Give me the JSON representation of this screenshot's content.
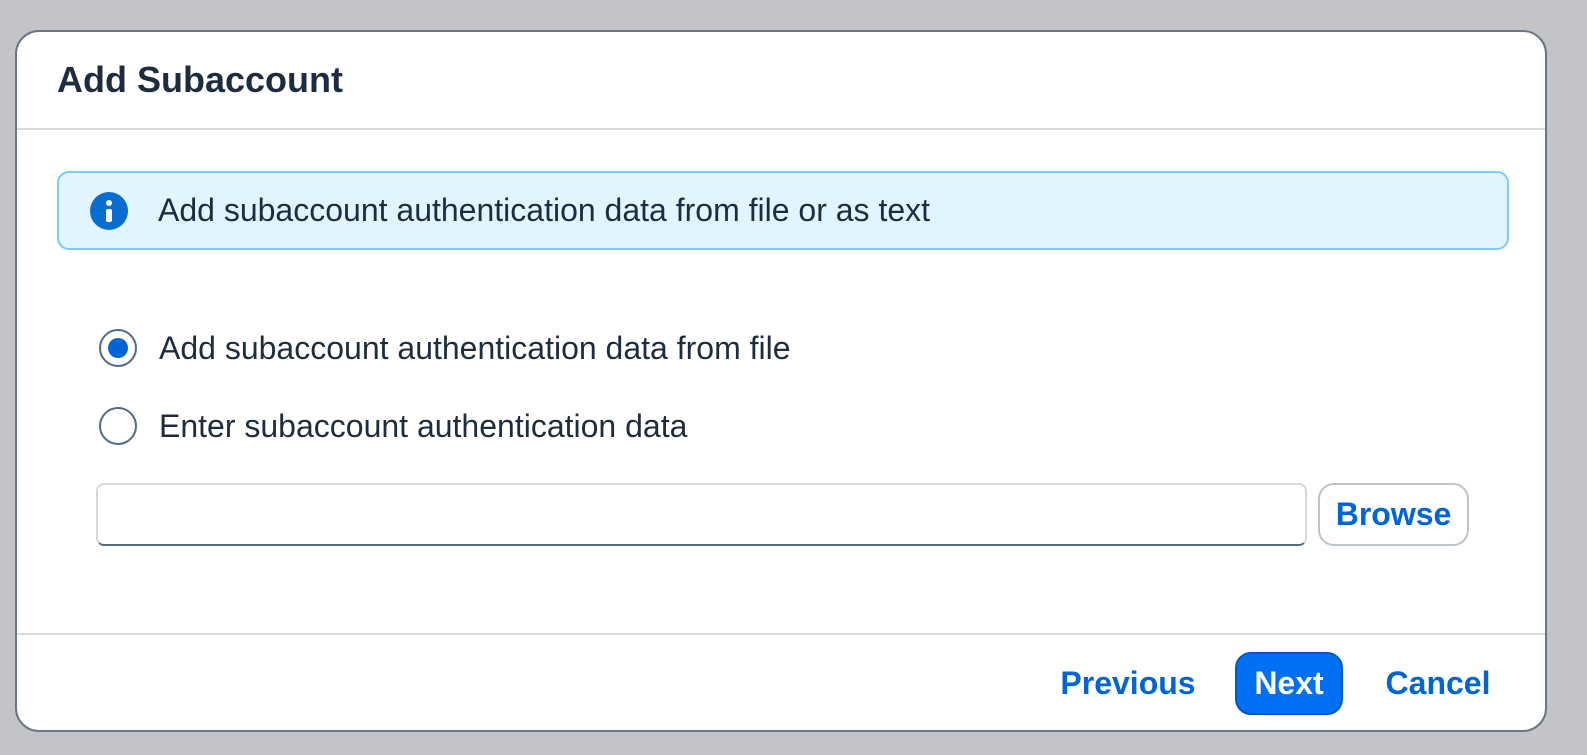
{
  "dialog": {
    "title": "Add Subaccount",
    "info_message": "Add subaccount authentication data from file or as text",
    "options": [
      {
        "label": "Add subaccount authentication data from file",
        "selected": true
      },
      {
        "label": "Enter subaccount authentication data",
        "selected": false
      }
    ],
    "file_input": {
      "value": "",
      "placeholder": ""
    },
    "browse_label": "Browse"
  },
  "footer": {
    "previous_label": "Previous",
    "next_label": "Next",
    "cancel_label": "Cancel"
  },
  "colors": {
    "accent": "#0064d9",
    "primary_button": "#0070f2",
    "info_background": "#e1f4ff",
    "info_border": "#7bcbf2",
    "overlay": "#c2c4c7"
  },
  "icons": {
    "info": "info-icon"
  }
}
